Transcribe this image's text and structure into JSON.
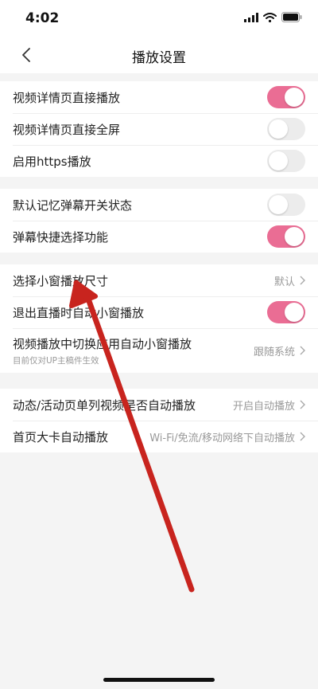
{
  "status_bar": {
    "time": "4:02"
  },
  "nav": {
    "title": "播放设置"
  },
  "groups": [
    {
      "items": [
        {
          "label": "视频详情页直接播放",
          "type": "toggle",
          "on": true
        },
        {
          "label": "视频详情页直接全屏",
          "type": "toggle",
          "on": false
        },
        {
          "label": "启用https播放",
          "type": "toggle",
          "on": false
        }
      ]
    },
    {
      "items": [
        {
          "label": "默认记忆弹幕开关状态",
          "type": "toggle",
          "on": false
        },
        {
          "label": "弹幕快捷选择功能",
          "type": "toggle",
          "on": true
        }
      ]
    },
    {
      "items": [
        {
          "label": "选择小窗播放尺寸",
          "type": "select",
          "value": "默认"
        },
        {
          "label": "退出直播时自动小窗播放",
          "type": "toggle",
          "on": true
        },
        {
          "label": "视频播放中切换应用自动小窗播放",
          "sublabel": "目前仅对UP主稿件生效",
          "type": "select",
          "value": "跟随系统"
        }
      ]
    },
    {
      "items": [
        {
          "label": "动态/活动页单列视频是否自动播放",
          "type": "select",
          "value": "开启自动播放"
        },
        {
          "label": "首页大卡自动播放",
          "type": "select",
          "value": "Wi-Fi/免流/移动网络下自动播放"
        }
      ]
    }
  ],
  "colors": {
    "toggle_on": "#ea6d94",
    "toggle_off": "#ececec",
    "annotation_arrow": "#c8241e"
  }
}
